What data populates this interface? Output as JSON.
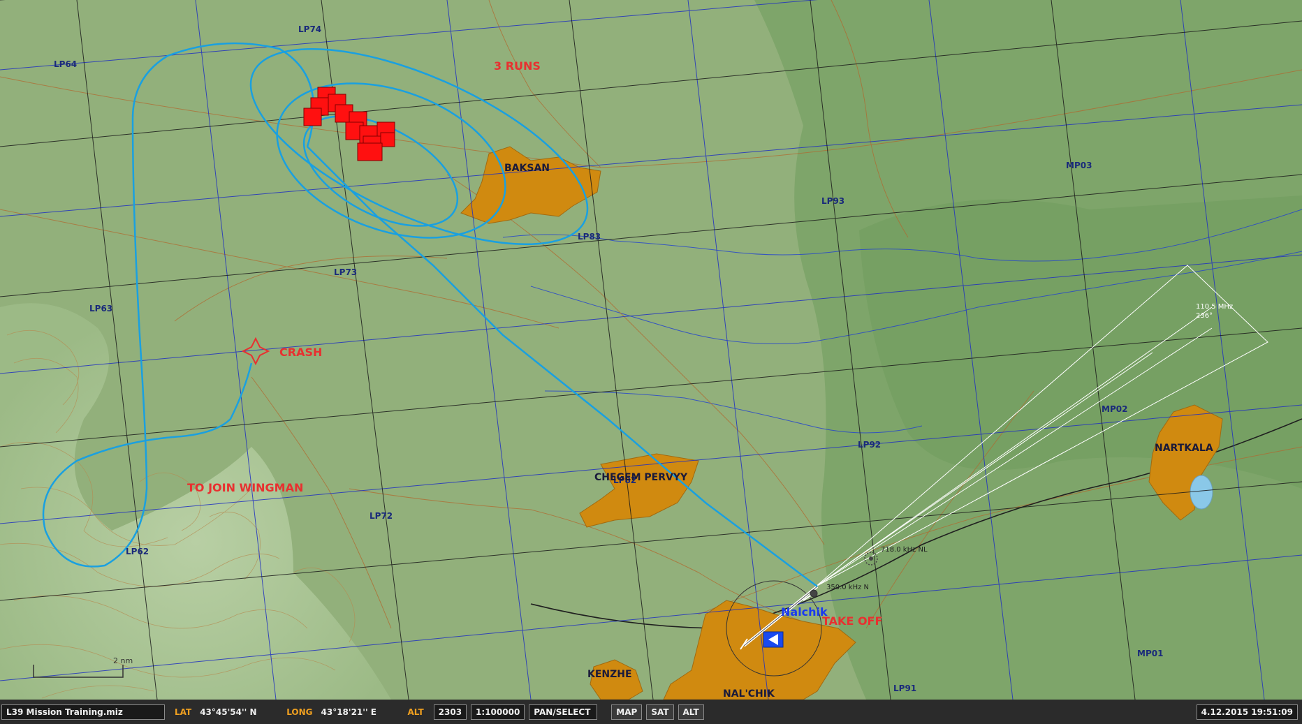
{
  "map": {
    "colors": {
      "terrain": "#8fad78",
      "plains_dark": "#7ea56a",
      "town_fill": "#d08a10",
      "route_line": "#1aa0e0",
      "grid_major": "#1a1a1a",
      "grid_minor": "#2030c0",
      "annotation": "#e83030",
      "target_fill": "#ff1010"
    },
    "grid_labels": [
      "LP74",
      "LP64",
      "LP63",
      "LP73",
      "LP83",
      "LP93",
      "MP03",
      "LP62",
      "LP72",
      "LP82",
      "LP92",
      "MP02",
      "LP91",
      "MP01"
    ],
    "towns": {
      "baksan": "BAKSAN",
      "chegem": "CHEGEM PERVYY",
      "nartkala": "NARTKALA",
      "kenzhe": "KENZHE",
      "nalchik_town": "NAL'CHIK"
    },
    "annotations": {
      "runs": "3 RUNS",
      "crash": "CRASH",
      "join": "TO JOIN WINGMAN",
      "takeoff": "TAKE OFF"
    },
    "airfield": {
      "name": "Nalchik"
    },
    "navaids": {
      "ndb_far": "718.0 kHz NL",
      "ndb_near": "350.0 kHz N",
      "ils_freq": "110.5 MHz",
      "ils_course": "236°"
    },
    "scale": {
      "label": "2 nm"
    }
  },
  "statusbar": {
    "mission_file": "L39 Mission Training.miz",
    "lat_label": "LAT",
    "lat_value": "43°45'54'' N",
    "long_label": "LONG",
    "long_value": "43°18'21'' E",
    "alt_label": "ALT",
    "alt_value": "2303",
    "scale_value": "1:100000",
    "mode": "PAN/SELECT",
    "btn_map": "MAP",
    "btn_sat": "SAT",
    "btn_alt": "ALT",
    "datetime": "4.12.2015 19:51:09"
  }
}
